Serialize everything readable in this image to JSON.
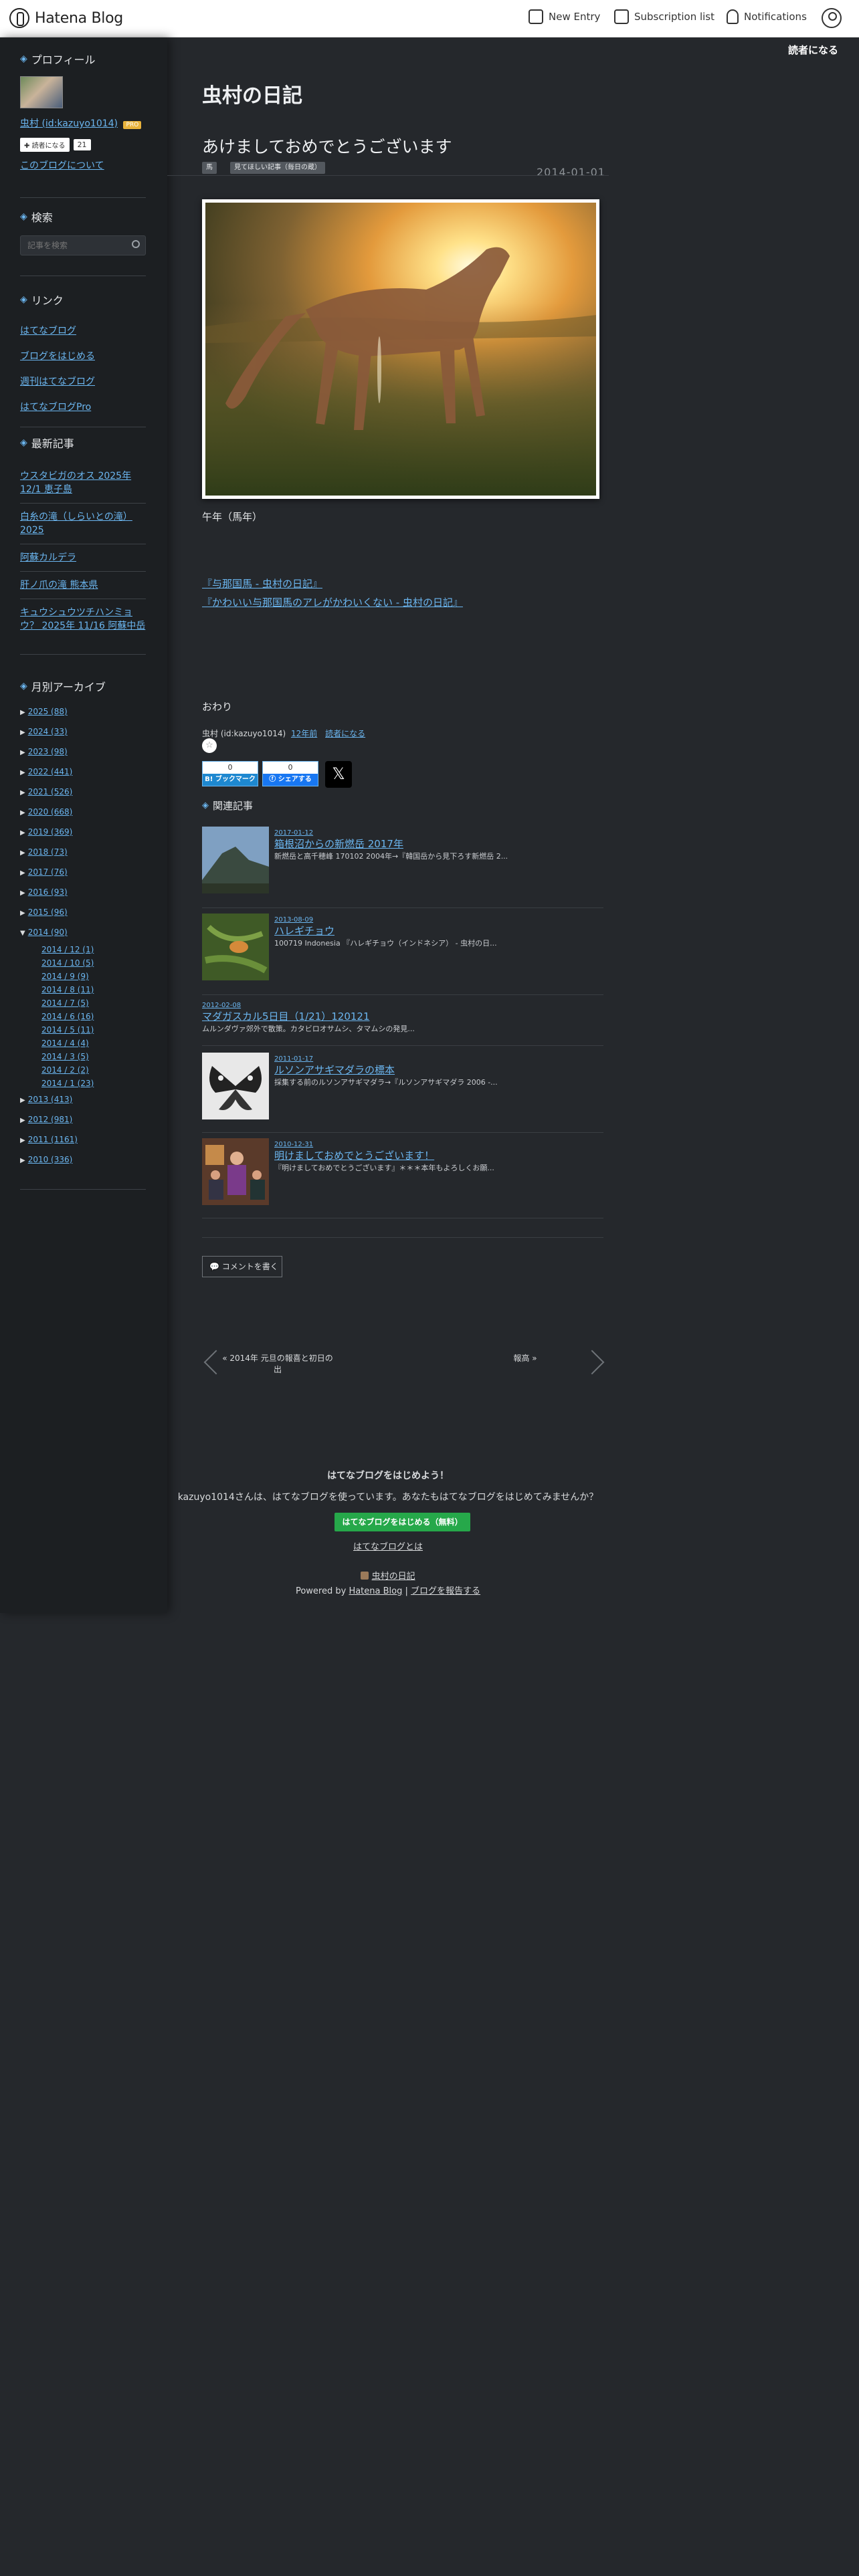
{
  "topbar": {
    "logo_text": "Hatena Blog",
    "new_entry": "New Entry",
    "subscription": "Subscription list",
    "notifications": "Notifications"
  },
  "reader_button": "読者になる",
  "sidebar": {
    "profile_heading": "プロフィール",
    "profile_name": "虫村 (id:kazuyo1014)",
    "pro_badge": "PRO",
    "subscribe_label": "読者になる",
    "subscriber_count": "21",
    "about_link": "このブログについて",
    "search_heading": "検索",
    "search_placeholder": "記事を検索",
    "links_heading": "リンク",
    "links": [
      "はてなブログ",
      "ブログをはじめる",
      "週刊はてなブログ",
      "はてなブログPro"
    ],
    "recent_heading": "最新記事",
    "recent": [
      "ウスタビガのオス 2025年12/1 恵子島",
      "白糸の滝（しらいとの滝） 2025",
      "阿蘇カルデラ",
      "肝ノ爪の滝 熊本県",
      "キュウシュウツチハンミョウ？ 2025年 11/16 阿蘇中岳"
    ],
    "archive_heading": "月別アーカイブ",
    "archive_top": [
      "2025 (88)",
      "2024 (33)",
      "2023 (98)",
      "2022 (441)",
      "2021 (526)",
      "2020 (668)",
      "2019 (369)",
      "2018 (73)",
      "2017 (76)",
      "2016 (93)",
      "2015 (96)",
      "2014 (90)"
    ],
    "archive_months": [
      "2014 / 12 (1)",
      "2014 / 10 (5)",
      "2014 / 9 (9)",
      "2014 / 8 (11)",
      "2014 / 7 (5)",
      "2014 / 6 (16)",
      "2014 / 5 (11)",
      "2014 / 4 (4)",
      "2014 / 3 (5)",
      "2014 / 2 (2)",
      "2014 / 1 (23)"
    ],
    "archive_bottom": [
      "2013 (413)",
      "2012 (981)",
      "2011 (1161)",
      "2010 (336)"
    ]
  },
  "blog_title": "虫村の日記",
  "entry": {
    "title": "あけましておめでとうございます",
    "categories": [
      "馬",
      "見てほしい記事（毎日の蔵）"
    ],
    "date": "2014-01-01",
    "caption": "午年（馬年）",
    "links": [
      "『与那国馬 - 虫村の日記』",
      "『かわいい与那国馬のアレがかわいくない - 虫村の日記』"
    ],
    "end_text": "おわり",
    "author_line": "虫村 (id:kazuyo1014)",
    "time_ago": "12年前",
    "subscribe": "読者になる"
  },
  "share": {
    "hatena_count": "0",
    "hatena_label": "B! ブックマーク",
    "fb_count": "0",
    "fb_label": "シェアする",
    "x_label": "𝕏"
  },
  "related_heading": "関連記事",
  "related": [
    {
      "date": "2017-01-12",
      "title": "箱根沼からの新燃岳 2017年",
      "excerpt": "新燃岳と高千穂峰 170102 2004年→『韓国岳から見下ろす新燃岳 2..."
    },
    {
      "date": "2013-08-09",
      "title": "ハレギチョウ",
      "excerpt": "100719 Indonesia 『ハレギチョウ（インドネシア） - 虫村の日..."
    },
    {
      "date": "2012-02-08",
      "title": "マダガスカル5日目（1/21）120121",
      "excerpt": "ムルンダヴァ郊外で散策。カタビロオサムシ、タマムシの発見..."
    },
    {
      "date": "2011-01-17",
      "title": "ルソンアサギマダラの標本",
      "excerpt": "採集する前のルソンアサギマダラ→『ルソンアサギマダラ 2006 -..."
    },
    {
      "date": "2010-12-31",
      "title": "明けましておめでとうございます！",
      "excerpt": "『明けましておめでとうございます』＊＊＊本年もよろしくお願..."
    }
  ],
  "comment_button": "コメントを書く",
  "pager": {
    "prev": "« 2014年 元旦の報喜と初日の出",
    "next": "報高 »"
  },
  "footer": {
    "cta_title": "はてなブログをはじめよう！",
    "cta_text": "kazuyo1014さんは、はてなブログを使っています。あなたもはてなブログをはじめてみませんか？",
    "cta_button": "はてなブログをはじめる（無料）",
    "about_link": "はてなブログとは",
    "blog_name": "虫村の日記",
    "powered_prefix": "Powered by",
    "powered_link": "Hatena Blog",
    "separator": "|",
    "report_link": "ブログを報告する"
  }
}
